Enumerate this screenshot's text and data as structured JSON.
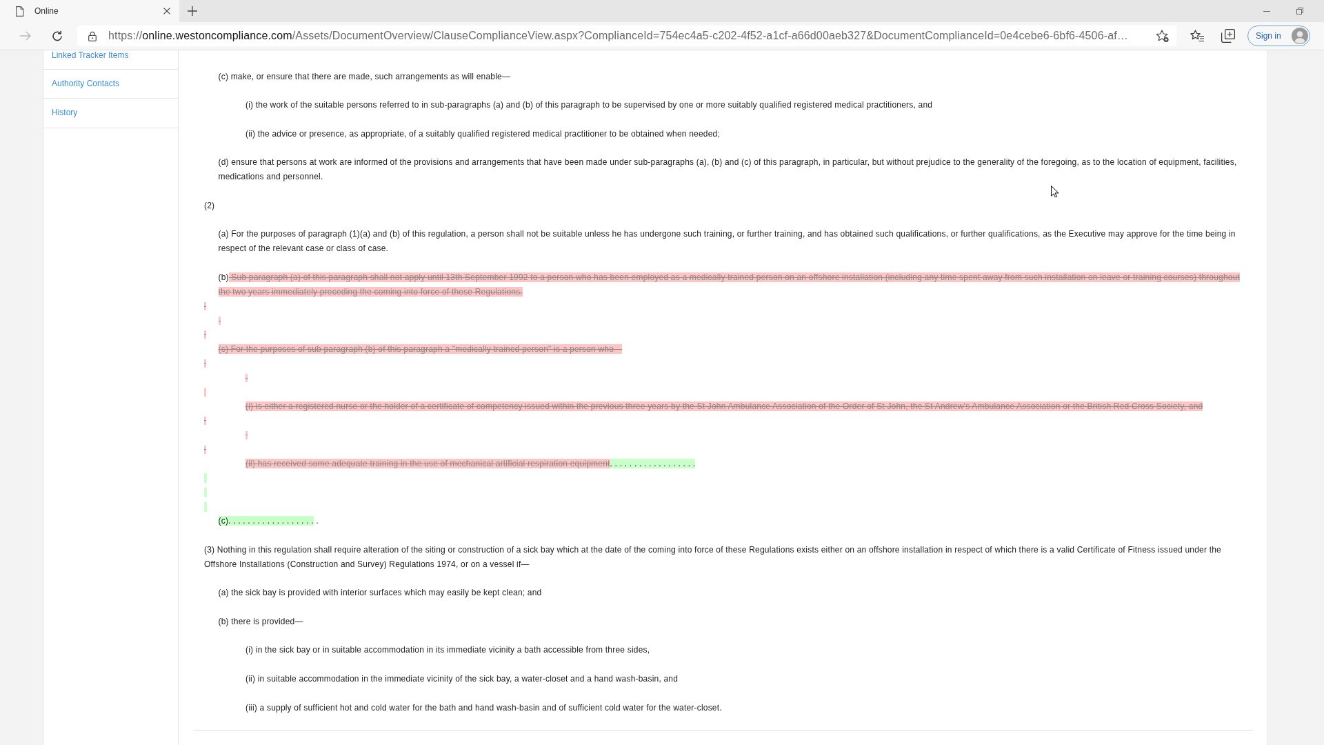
{
  "browser": {
    "tab": {
      "title": "Online"
    },
    "forward_button": {
      "disabled": true
    },
    "address_bar": {
      "scheme": "https://",
      "host": "online.westoncompliance.com",
      "path": "/Assets/DocumentOverview/ClauseComplianceView.aspx?ComplianceId=754ec4a5-c202-4f52-a1cf-a66d00aeb327&DocumentComplianceId=0e4cebe6-6bf6-4506-af…"
    },
    "sign_in_button": {
      "label": "Sign in"
    }
  },
  "sidebar": {
    "items": [
      {
        "label": "Linked Tracker Items"
      },
      {
        "label": "Authority Contacts"
      },
      {
        "label": "History"
      }
    ]
  },
  "document": {
    "outline": [
      {
        "children": [
          {
            "kind": "text",
            "segments": [
              {
                "kind": "plain",
                "text": "(c) make, or ensure that there are made, such arrangements as will enable—"
              }
            ],
            "children": [
              {
                "kind": "text",
                "segments": [
                  {
                    "kind": "plain",
                    "text": "(i) the work of the suitable persons referred to in sub-paragraphs (a) and (b) of this paragraph to be supervised by one or more suitably qualified registered medical practitioners, and"
                  }
                ]
              },
              {
                "kind": "text",
                "segments": [
                  {
                    "kind": "plain",
                    "text": "(ii) the advice or presence, as appropriate, of a suitably qualified registered medical practitioner to be obtained when needed;"
                  }
                ]
              }
            ]
          },
          {
            "kind": "text",
            "segments": [
              {
                "kind": "plain",
                "text": "(d) ensure that persons at work are informed of the provisions and arrangements that have been made under sub-paragraphs (a), (b) and (c) of this paragraph, in particular, but without prejudice to the generality of the foregoing, as to the location of equipment, facilities, medications and personnel."
              }
            ]
          }
        ]
      },
      {
        "kind": "text",
        "segments": [
          {
            "kind": "plain",
            "text": "(2)"
          }
        ],
        "children": [
          {
            "kind": "text",
            "segments": [
              {
                "kind": "plain",
                "text": "(a) For the purposes of paragraph (1)(a) and (b) of this regulation, a person shall not be suitable unless he has undergone such training, or further training, and has obtained such qualifications, or further qualifications, as the Executive may approve for the time being in respect of the relevant case or class of case."
              }
            ]
          },
          {
            "kind": "text",
            "segments": [
              {
                "kind": "plain",
                "text": "(b)"
              },
              {
                "kind": "deleted",
                "text": " Sub paragraph (a) of this paragraph shall not apply until 13th September 1992 to a person who has been employed as a medically trained person on an offshore installation (including any time spent away from such installation on leave or training courses) throughout the two years immediately preceding the coming into force of these Regulations."
              }
            ]
          }
        ]
      },
      {
        "kind": "mark",
        "inserted": false,
        "children": [
          {
            "kind": "mark",
            "inserted": false
          }
        ]
      },
      {
        "kind": "mark",
        "inserted": false,
        "children": [
          {
            "kind": "text",
            "segments": [
              {
                "kind": "deleted",
                "text": "(c) For the purposes of sub paragraph (b) of this paragraph a \"medically trained person\" is a person who—"
              }
            ]
          }
        ]
      },
      {
        "kind": "mark",
        "inserted": false,
        "children": [
          {
            "children": [
              {
                "kind": "mark",
                "inserted": false
              }
            ]
          }
        ]
      },
      {
        "kind": "mark",
        "inserted": false,
        "children": [
          {
            "children": [
              {
                "kind": "text",
                "segments": [
                  {
                    "kind": "deleted",
                    "text": "(i) is either a registered nurse or the holder of a certificate of competency issued within the previous three years by the St John Ambulance Association of the Order of St John, the St Andrew’s Ambulance Association or the British Red Cross Society, and"
                  }
                ]
              }
            ]
          }
        ]
      },
      {
        "kind": "mark",
        "inserted": false,
        "children": [
          {
            "children": [
              {
                "kind": "mark",
                "inserted": false
              }
            ]
          }
        ]
      },
      {
        "kind": "mark",
        "inserted": false,
        "children": [
          {
            "children": [
              {
                "kind": "text",
                "segments": [
                  {
                    "kind": "deleted",
                    "text": "(ii) has received some adequate training in the use of mechanical artificial respiration equipment"
                  },
                  {
                    "kind": "inserted",
                    "text": ". . . . . . . . . . . . . . . . . ."
                  }
                ]
              }
            ]
          }
        ]
      },
      {
        "kind": "mark",
        "inserted": true
      },
      {
        "kind": "mark",
        "inserted": true
      },
      {
        "kind": "mark",
        "inserted": true,
        "children": [
          {
            "kind": "text",
            "segments": [
              {
                "kind": "inserted",
                "text": "(c). . . . . . . . . . . . . . . . . ."
              },
              {
                "kind": "plain",
                "text": " ."
              }
            ]
          }
        ]
      },
      {
        "kind": "text",
        "segments": [
          {
            "kind": "plain",
            "text": "(3) Nothing in this regulation shall require alteration of the siting or construction of a sick bay which at the date of the coming into force of these Regulations exists either on an offshore installation in respect of which there is a valid Certificate of Fitness issued under the Offshore Installations (Construction and Survey) Regulations 1974, or on a vessel if—"
          }
        ],
        "children": [
          {
            "kind": "text",
            "segments": [
              {
                "kind": "plain",
                "text": "(a) the sick bay is provided with interior surfaces which may easily be kept clean; and"
              }
            ]
          },
          {
            "kind": "text",
            "segments": [
              {
                "kind": "plain",
                "text": "(b) there is provided—"
              }
            ],
            "children": [
              {
                "kind": "text",
                "segments": [
                  {
                    "kind": "plain",
                    "text": "(i) in the sick bay or in suitable accommodation in its immediate vicinity a bath accessible from three sides,"
                  }
                ]
              },
              {
                "kind": "text",
                "segments": [
                  {
                    "kind": "plain",
                    "text": "(ii) in suitable accommodation in the immediate vicinity of the sick bay, a water-closet and a hand wash-basin, and"
                  }
                ]
              },
              {
                "kind": "text",
                "segments": [
                  {
                    "kind": "plain",
                    "text": "(iii) a supply of sufficient hot and cold water for the bath and hand wash-basin and of sufficient cold water for the water-closet."
                  }
                ]
              }
            ]
          }
        ]
      }
    ]
  }
}
